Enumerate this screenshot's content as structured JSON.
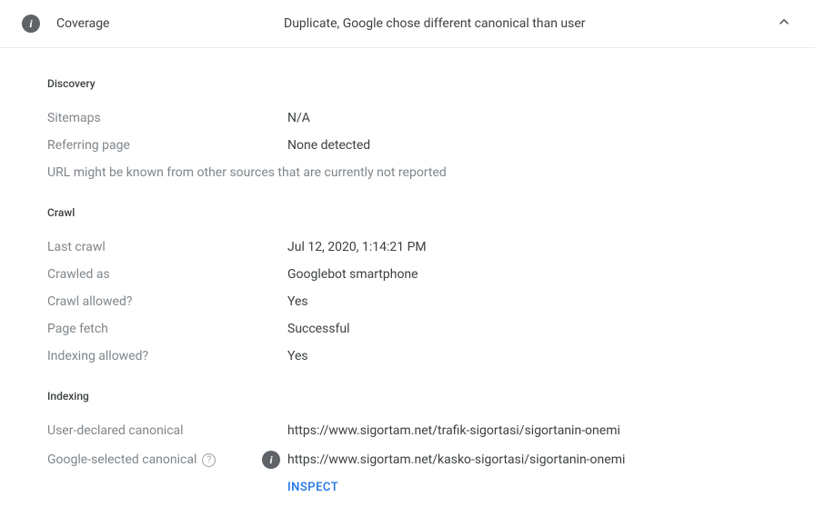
{
  "header": {
    "label": "Coverage",
    "value": "Duplicate, Google chose different canonical than user"
  },
  "discovery": {
    "title": "Discovery",
    "sitemaps_label": "Sitemaps",
    "sitemaps_value": "N/A",
    "referring_label": "Referring page",
    "referring_value": "None detected",
    "note": "URL might be known from other sources that are currently not reported"
  },
  "crawl": {
    "title": "Crawl",
    "last_crawl_label": "Last crawl",
    "last_crawl_value": "Jul 12, 2020, 1:14:21 PM",
    "crawled_as_label": "Crawled as",
    "crawled_as_value": "Googlebot smartphone",
    "crawl_allowed_label": "Crawl allowed?",
    "crawl_allowed_value": "Yes",
    "page_fetch_label": "Page fetch",
    "page_fetch_value": "Successful",
    "indexing_allowed_label": "Indexing allowed?",
    "indexing_allowed_value": "Yes"
  },
  "indexing": {
    "title": "Indexing",
    "user_canonical_label": "User-declared canonical",
    "user_canonical_value": "https://www.sigortam.net/trafik-sigortasi/sigortanin-onemi",
    "google_canonical_label": "Google-selected canonical",
    "google_canonical_value": "https://www.sigortam.net/kasko-sigortasi/sigortanin-onemi",
    "inspect_label": "INSPECT"
  }
}
